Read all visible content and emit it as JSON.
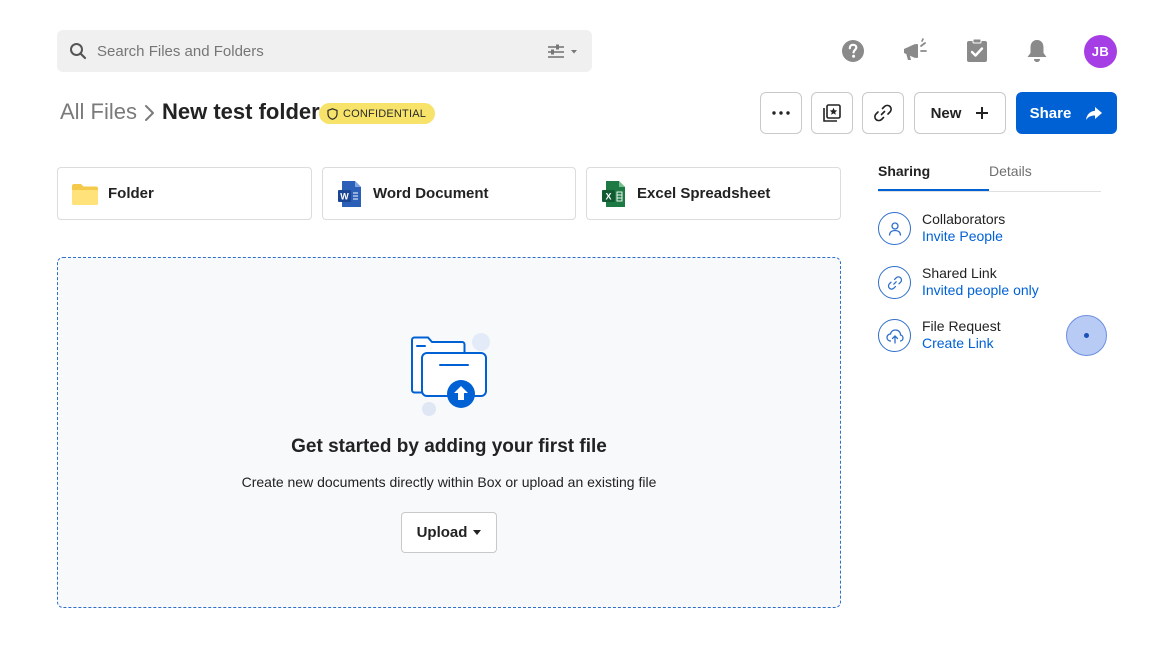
{
  "search": {
    "placeholder": "Search Files and Folders"
  },
  "header": {
    "avatar_initials": "JB",
    "icons": [
      "help-icon",
      "announcements-icon",
      "tasks-icon",
      "notifications-icon"
    ]
  },
  "breadcrumb": {
    "root": "All Files",
    "current": "New test folder",
    "classification_badge": "CONFIDENTIAL"
  },
  "toolbar": {
    "new_label": "New",
    "share_label": "Share"
  },
  "create_cards": [
    {
      "label": "Folder",
      "icon": "folder-icon"
    },
    {
      "label": "Word Document",
      "icon": "word-icon"
    },
    {
      "label": "Excel Spreadsheet",
      "icon": "excel-icon"
    }
  ],
  "empty_state": {
    "title": "Get started by adding your first file",
    "subtitle": "Create new documents directly within Box or upload an existing file",
    "upload_label": "Upload"
  },
  "sidebar": {
    "tabs": [
      {
        "label": "Sharing",
        "active": true
      },
      {
        "label": "Details",
        "active": false
      }
    ],
    "items": [
      {
        "title": "Collaborators",
        "action": "Invite People",
        "icon": "person-icon"
      },
      {
        "title": "Shared Link",
        "action": "Invited people only",
        "icon": "link-icon"
      },
      {
        "title": "File Request",
        "action": "Create Link",
        "icon": "upload-cloud-icon"
      }
    ]
  },
  "colors": {
    "accent": "#0061d5",
    "avatar": "#a63ee6",
    "badge": "#f7e36a",
    "folder": "#ffd966",
    "word": "#2b5fb8",
    "excel": "#1e7a45"
  }
}
